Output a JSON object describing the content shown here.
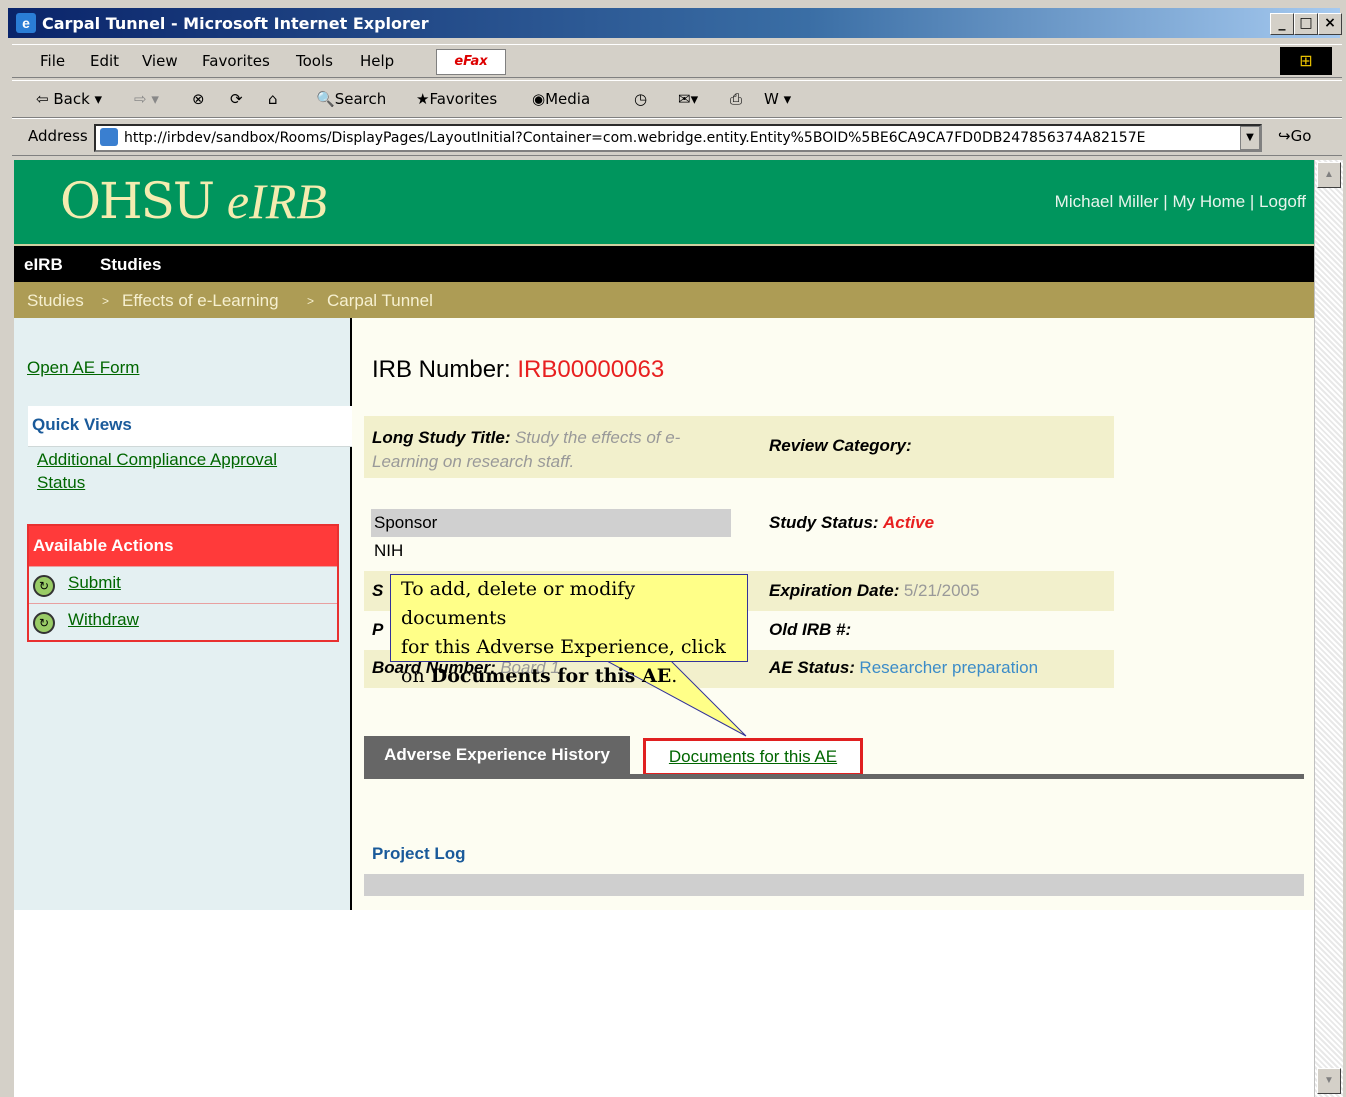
{
  "window": {
    "title": "Carpal Tunnel - Microsoft Internet Explorer",
    "min": "_",
    "max": "□",
    "close": "×"
  },
  "menu": [
    "File",
    "Edit",
    "View",
    "Favorites",
    "Tools",
    "Help"
  ],
  "efax": "eFax",
  "toolbar": {
    "back": "⇦ Back ▾",
    "forward": "⇨ ▾",
    "stop": "⊗",
    "refresh": "⟳",
    "home": "⌂",
    "search": "Search",
    "favorites": "Favorites",
    "media": "Media",
    "history": "◷",
    "mail": "✉▾",
    "print": "⎙",
    "edit": "W ▾"
  },
  "address": {
    "label": "Address",
    "url": "http://irbdev/sandbox/Rooms/DisplayPages/LayoutInitial?Container=com.webridge.entity.Entity%5BOID%5BE6CA9CA7FD0DB247856374A82157E",
    "go": "Go"
  },
  "header": {
    "logo_main": "OHSU",
    "logo_italic": "eIRB",
    "user_links": "Michael Miller | My Home |   Logoff"
  },
  "nav": [
    "eIRB",
    "Studies"
  ],
  "breadcrumb": [
    "Studies",
    ">",
    "Effects of e-Learning",
    ">",
    "Carpal Tunnel"
  ],
  "sidebar": {
    "open_ae": "Open AE Form",
    "quick_views_title": "Quick Views",
    "quick_views_link_1": "Additional Compliance Approval",
    "quick_views_link_2": "Status",
    "actions_title": "Available Actions",
    "actions": [
      "Submit",
      "Withdraw"
    ]
  },
  "main": {
    "irb_label": "IRB Number:",
    "irb_value": "IRB00000063",
    "long_title_label": "Long Study Title:",
    "long_title_value_1": "Study the effects of e-",
    "long_title_value_2": "Learning on research staff.",
    "review_category_label": "Review Category:",
    "sponsor_label": "Sponsor",
    "sponsor_value": "NIH",
    "study_status_label": "Study Status:",
    "study_status_value": "Active",
    "row3_label_fragment": "S",
    "expiration_label": "Expiration Date:",
    "expiration_value": "5/21/2005",
    "row4_label_fragment": "P",
    "old_irb_label": "Old IRB #:",
    "board_label": "Board Number:",
    "board_value": "Board 1",
    "ae_status_label": "AE Status:",
    "ae_status_value": "Researcher preparation",
    "tab_history": "Adverse Experience History",
    "tab_documents": "Documents for this AE",
    "project_log": "Project Log"
  },
  "callout": {
    "line1": "To add, delete or modify documents",
    "line2": "for this Adverse Experience, click",
    "line3_prefix": "on",
    "line3_bold": "Documents for this AE",
    "line3_suffix": "."
  },
  "colors": {
    "header_green": "#00955d",
    "breadcrumb_gold": "#ad9c55",
    "alert_red": "#e02020",
    "link_green": "#006600",
    "title_blue": "#1a5a9a",
    "status_link_blue": "#3c8cc8"
  }
}
